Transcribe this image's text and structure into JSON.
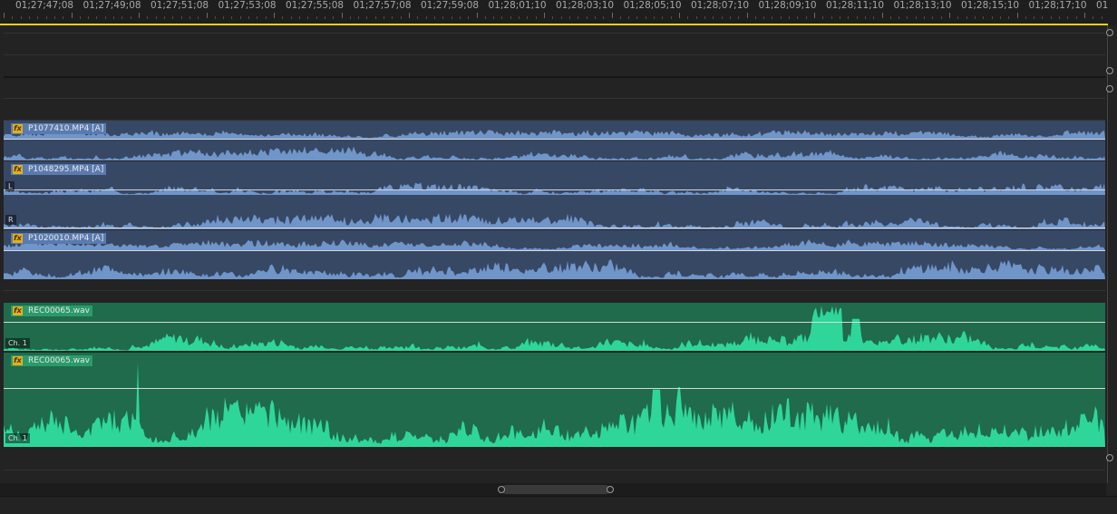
{
  "ruler": {
    "timecodes": [
      "01;27;47;08",
      "01;27;49;08",
      "01;27;51;08",
      "01;27;53;08",
      "01;27;55;08",
      "01;27;57;08",
      "01;27;59;08",
      "01;28;01;10",
      "01;28;03;10",
      "01;28;05;10",
      "01;28;07;10",
      "01;28;09;10",
      "01;28;11;10",
      "01;28;13;10",
      "01;28;15;10",
      "01;28;17;10",
      "01"
    ]
  },
  "clips": [
    {
      "name": "P1077410.MP4 [A]",
      "fx": "fx",
      "color": "#6f95c9"
    },
    {
      "name": "P1048295.MP4 [A]",
      "fx": "fx",
      "color": "#6f95c9",
      "channel_left": "L",
      "channel_right": "R"
    },
    {
      "name": "P1020010.MP4 [A]",
      "fx": "fx",
      "color": "#6f95c9"
    },
    {
      "name": "REC00065.wav",
      "fx": "fx",
      "color": "#2fd69a",
      "channel": "Ch. 1"
    },
    {
      "name": "REC00065.wav",
      "fx": "fx",
      "color": "#2fd69a",
      "channel": "Ch. 1"
    }
  ],
  "colors": {
    "playhead_bar": "#e6d21a",
    "video_audio_clip": "#374865",
    "audio_clip": "#1f6b4c"
  }
}
